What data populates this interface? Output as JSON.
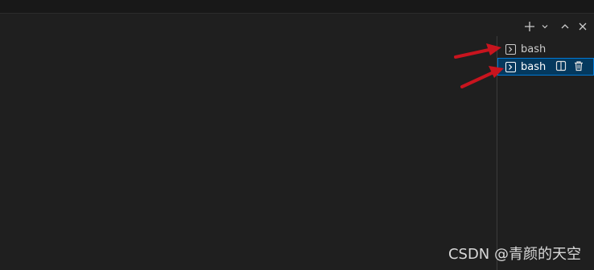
{
  "panel": {
    "toolbar": {
      "new_terminal_icon": "plus-icon",
      "dropdown_icon": "chevron-down-icon",
      "maximize_icon": "chevron-up-icon",
      "close_icon": "close-icon"
    }
  },
  "terminal_tabs": [
    {
      "label": "bash",
      "icon": "terminal-icon",
      "active": false
    },
    {
      "label": "bash",
      "icon": "terminal-icon",
      "active": true,
      "actions": [
        "split-terminal-icon",
        "trash-icon"
      ]
    }
  ],
  "colors": {
    "background": "#1f1f1f",
    "active_tab_bg": "#04395e",
    "active_tab_border": "#0078d4",
    "annotation_arrow": "#c8141e"
  },
  "watermark": "CSDN @青颜的天空"
}
